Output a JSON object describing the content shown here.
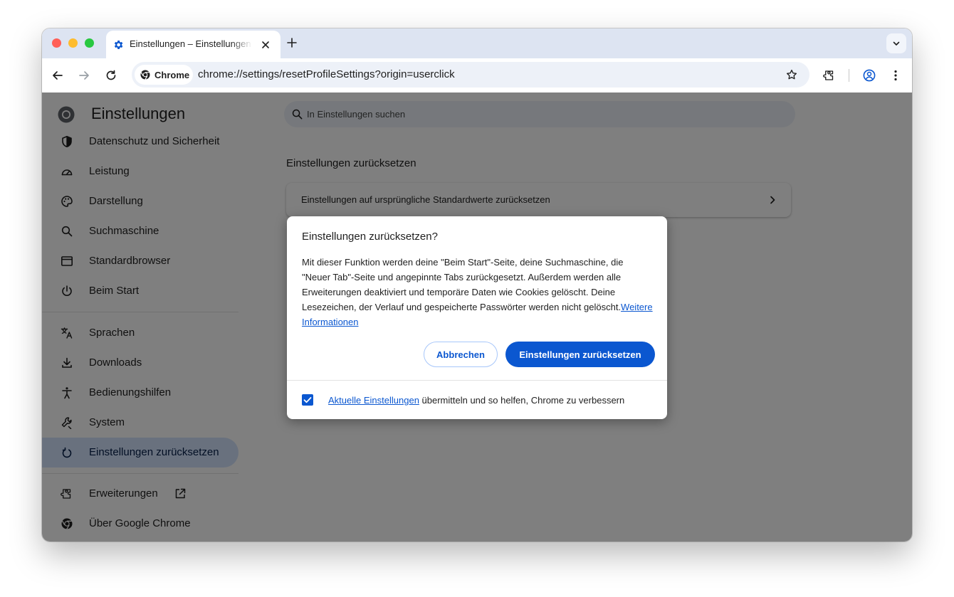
{
  "browser": {
    "tab_title": "Einstellungen – Einstellungen",
    "url": "chrome://settings/resetProfileSettings?origin=userclick",
    "chip_label": "Chrome"
  },
  "colors": {
    "accent": "#0b57d0",
    "tabstrip": "#dde4f2",
    "active_nav": "#d3e3fd"
  },
  "settings": {
    "title": "Einstellungen",
    "search_placeholder": "In Einstellungen suchen",
    "nav": [
      {
        "label": "Datenschutz und Sicherheit",
        "icon": "shield-icon"
      },
      {
        "label": "Leistung",
        "icon": "speedometer-icon"
      },
      {
        "label": "Darstellung",
        "icon": "palette-icon"
      },
      {
        "label": "Suchmaschine",
        "icon": "search-icon"
      },
      {
        "label": "Standardbrowser",
        "icon": "browser-window-icon"
      },
      {
        "label": "Beim Start",
        "icon": "power-icon"
      },
      {
        "label": "Sprachen",
        "icon": "translate-icon"
      },
      {
        "label": "Downloads",
        "icon": "download-icon"
      },
      {
        "label": "Bedienungshilfen",
        "icon": "accessibility-icon"
      },
      {
        "label": "System",
        "icon": "wrench-icon"
      },
      {
        "label": "Einstellungen zurücksetzen",
        "icon": "reset-icon"
      },
      {
        "label": "Erweiterungen",
        "icon": "puzzle-icon"
      },
      {
        "label": "Über Google Chrome",
        "icon": "chrome-icon"
      }
    ],
    "active_nav": "Einstellungen zurücksetzen",
    "section_title": "Einstellungen zurücksetzen",
    "card_label": "Einstellungen auf ursprüngliche Standardwerte zurücksetzen"
  },
  "dialog": {
    "title": "Einstellungen zurücksetzen?",
    "body": "Mit dieser Funktion werden deine \"Beim Start\"-Seite, deine Suchmaschine, die \"Neuer Tab\"-Seite und angepinnte Tabs zurückgesetzt. Außerdem werden alle Erweiterungen deaktiviert und temporäre Daten wie Cookies gelöscht. Deine Lesezeichen, der Verlauf und gespeicherte Passwörter werden nicht gelöscht.",
    "learn_more": "Weitere Informationen",
    "cancel_label": "Abbrechen",
    "reset_label": "Einstellungen zurücksetzen",
    "checkbox_checked": true,
    "checkbox_link": "Aktuelle Einstellungen",
    "checkbox_text": " übermitteln und so helfen, Chrome zu verbessern"
  }
}
